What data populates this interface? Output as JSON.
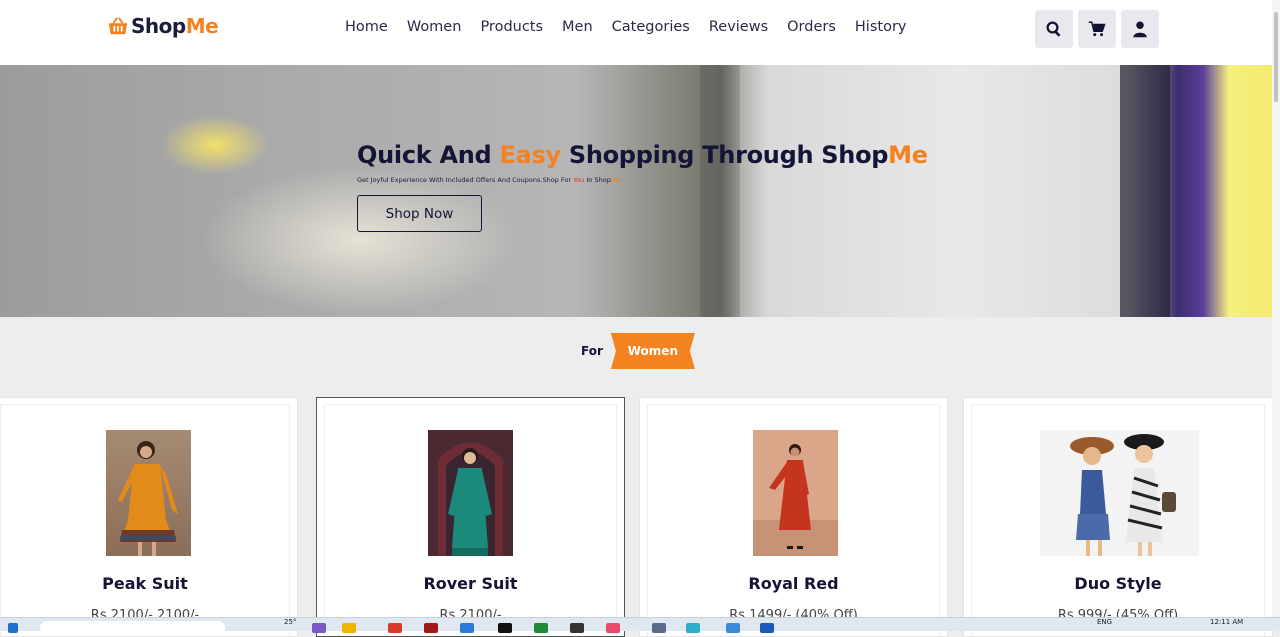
{
  "brand": {
    "name_part1": "Shop",
    "name_part2": "Me"
  },
  "nav": [
    "Home",
    "Women",
    "Products",
    "Men",
    "Categories",
    "Reviews",
    "Orders",
    "History"
  ],
  "actions": [
    {
      "icon": "search-icon"
    },
    {
      "icon": "cart-icon"
    },
    {
      "icon": "user-icon"
    }
  ],
  "hero": {
    "title_part1": "Quick And ",
    "title_accent": "Easy",
    "title_part2": " Shopping Through Shop",
    "title_accent2": "Me",
    "subtitle_part1": "Get Joyful Experience With Included Offers And Coupons.Shop For ",
    "subtitle_you": "You",
    "subtitle_part2": " In Shop",
    "subtitle_me": "Me!",
    "button": "Shop Now"
  },
  "section": {
    "prefix": "For",
    "tag": "Women"
  },
  "products": [
    {
      "name": "Peak Suit",
      "price": "Rs.2100/-  2100/-"
    },
    {
      "name": "Rover Suit",
      "price": "Rs.2100/-"
    },
    {
      "name": "Royal Red",
      "price": "Rs.1499/- (40% Off)"
    },
    {
      "name": "Duo Style",
      "price": "Rs.999/- (45% Off)"
    }
  ],
  "taskbar": {
    "weather": "25°",
    "lang": "ENG",
    "time": "12:11 AM"
  },
  "colors": {
    "accent": "#f58220",
    "navy": "#141436"
  }
}
